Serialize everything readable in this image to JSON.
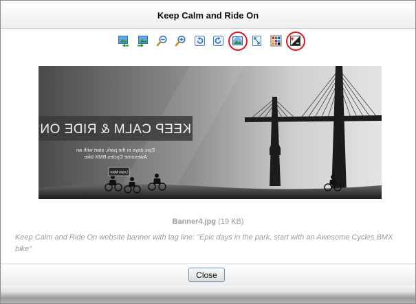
{
  "dialog": {
    "title": "Keep Calm and Ride On"
  },
  "toolbar": {
    "buttons": [
      {
        "name": "previous-image",
        "icon": "image-arrow-left-icon",
        "highlighted": false
      },
      {
        "name": "next-image",
        "icon": "image-arrow-right-icon",
        "highlighted": false
      },
      {
        "name": "zoom-out",
        "icon": "zoom-out-icon",
        "highlighted": false
      },
      {
        "name": "zoom-in",
        "icon": "zoom-in-icon",
        "highlighted": false
      },
      {
        "name": "rotate-left",
        "icon": "rotate-left-icon",
        "highlighted": false
      },
      {
        "name": "rotate-right",
        "icon": "rotate-right-icon",
        "highlighted": false
      },
      {
        "name": "fit-image",
        "icon": "fit-image-icon",
        "highlighted": true
      },
      {
        "name": "actual-size",
        "icon": "actual-size-icon",
        "highlighted": false
      },
      {
        "name": "background-color",
        "icon": "color-palette-icon",
        "highlighted": false
      },
      {
        "name": "auto-contrast",
        "icon": "contrast-icon",
        "highlighted": true
      }
    ],
    "highlight_color": "#e1141a"
  },
  "banner": {
    "headline": "KEEP CALM & RIDE ON",
    "tagline_line1": "Epic days in the park, start with an",
    "tagline_line2": "Awesome Cycles BMX bike",
    "cta": "Learn More",
    "mirrored": true
  },
  "file": {
    "name": "Banner4.jpg",
    "size": "(19 KB)"
  },
  "description": "Keep Calm and Ride On website banner with tag line: \"Epic days in the park, start with an Awesome Cycles BMX bike\"",
  "footer": {
    "close_label": "Close"
  }
}
